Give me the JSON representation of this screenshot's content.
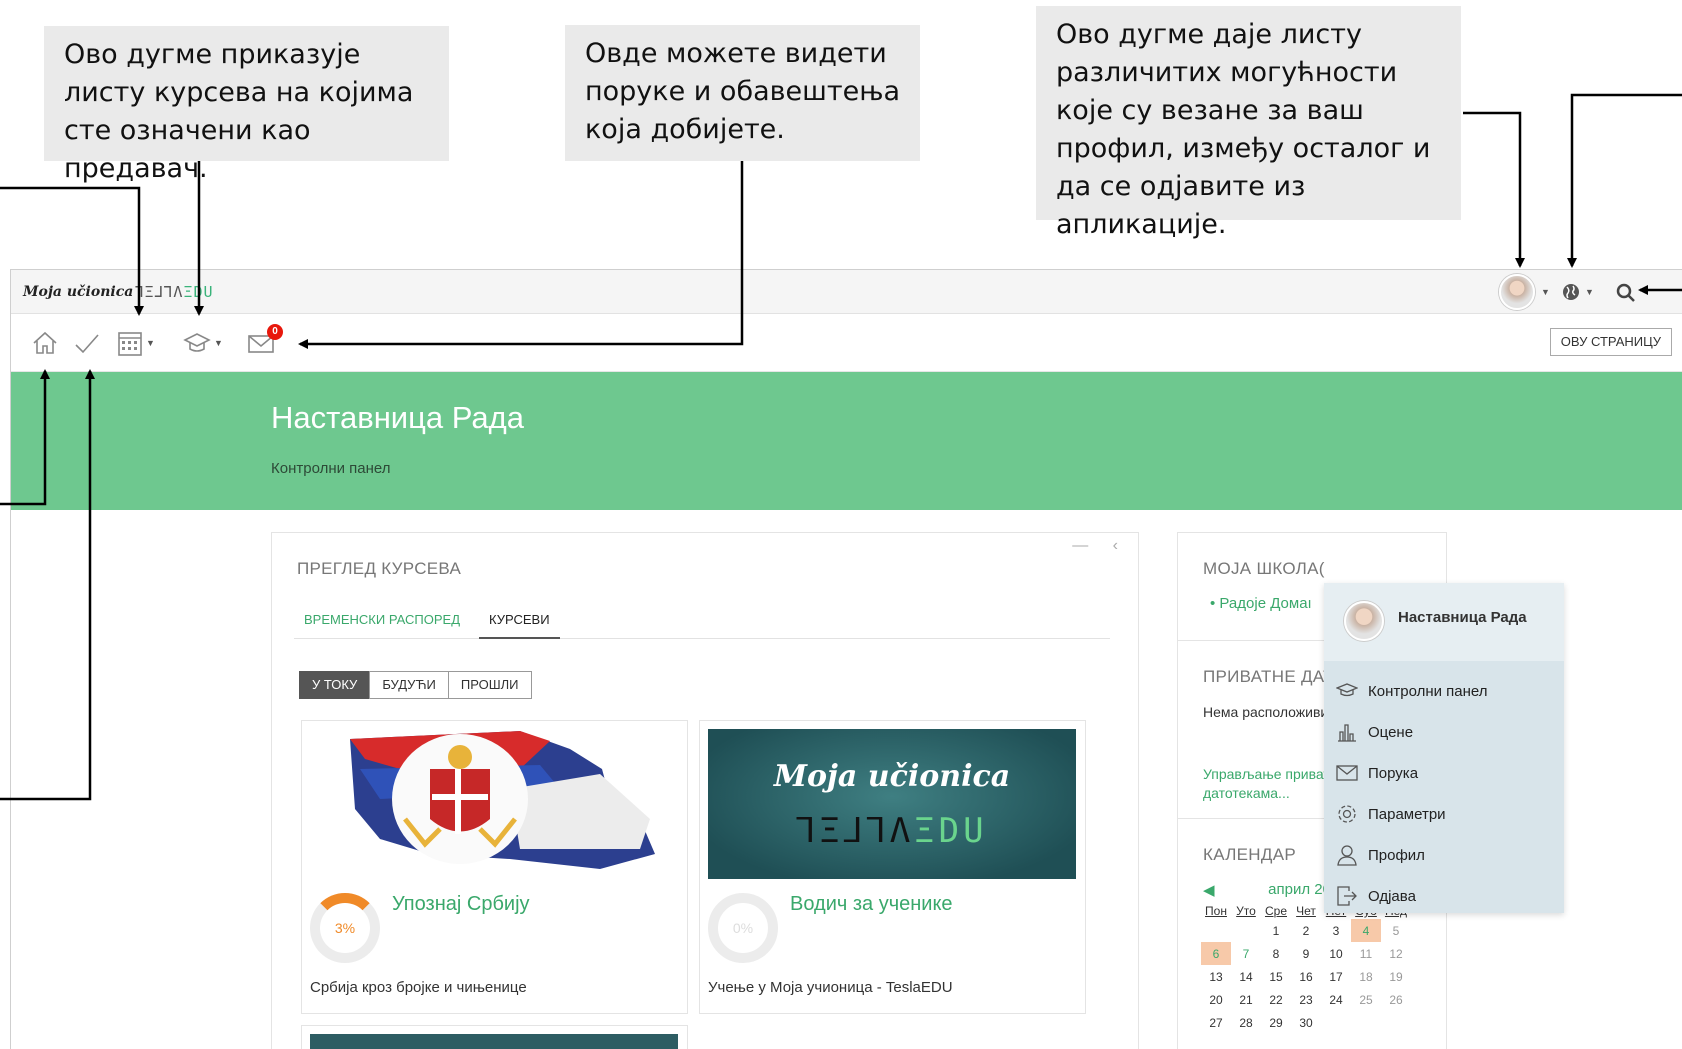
{
  "callouts": {
    "courses_menu": "Ово дугме приказује листу курсева на којима сте означени као предавач.",
    "messages": "Овде можете видети поруке и обавештења која добијете.",
    "profile_menu": "Ово дугме даје листу различитих могућности које су везане за ваш профил, између осталог и да се одјавите из апликације."
  },
  "topbar": {
    "logo_moja": "Moja učionica",
    "logo_tesla": "ꓶΞ⅃ꓶΛ",
    "logo_edu": "ΞDU"
  },
  "navbar": {
    "message_count": "0",
    "edit_button": "ОВУ СТРАНИЦУ"
  },
  "hero": {
    "title": "Наставница Рада",
    "subtitle": "Контролни панел"
  },
  "course_overview": {
    "title": "ПРЕГЛЕД КУРСЕВА",
    "tabs": [
      "ВРЕМЕНСКИ РАСПОРЕД",
      "КУРСЕВИ"
    ],
    "filters": [
      "У ТОКУ",
      "БУДУЋИ",
      "ПРОШЛИ"
    ],
    "cards": [
      {
        "title": "Упознај Србију",
        "progress_label": "3%",
        "progress": 3,
        "description": "Србија кроз бројке и чињенице"
      },
      {
        "title": "Водич за ученике",
        "progress_label": "0%",
        "progress": 0,
        "description": "Учење у Моја учионица - TeslaEDU"
      }
    ],
    "banner_line1": "Moja učionica",
    "banner_line2": "ꓶΞ⅃ꓶΛ",
    "banner_line3": "ΞDU"
  },
  "user_menu": {
    "name": "Наставница Рада",
    "items": [
      "Контролни панел",
      "Оцене",
      "Порука",
      "Параметри",
      "Профил",
      "Одјава"
    ]
  },
  "my_school": {
    "title": "МОЈА ШКОЛА(",
    "item": "Радоје Домаı"
  },
  "private_files": {
    "title": "ПРИВАТНЕ ДАТОТЕКЕ",
    "empty": "Нема расположивих датотека",
    "manage_link": "Управљање приватним датотекама..."
  },
  "calendar": {
    "title": "КАЛЕНДАР",
    "month": "април 2020.",
    "prev": "◀",
    "next": "▶",
    "weekdays": [
      "Пон",
      "Уто",
      "Сре",
      "Чет",
      "Пет",
      "Суб",
      "Нед"
    ],
    "weeks": [
      [
        "",
        "",
        "1",
        "2",
        "3",
        "4",
        "5"
      ],
      [
        "6",
        "7",
        "8",
        "9",
        "10",
        "11",
        "12"
      ],
      [
        "13",
        "14",
        "15",
        "16",
        "17",
        "18",
        "19"
      ],
      [
        "20",
        "21",
        "22",
        "23",
        "24",
        "25",
        "26"
      ],
      [
        "27",
        "28",
        "29",
        "30",
        "",
        "",
        ""
      ]
    ]
  }
}
